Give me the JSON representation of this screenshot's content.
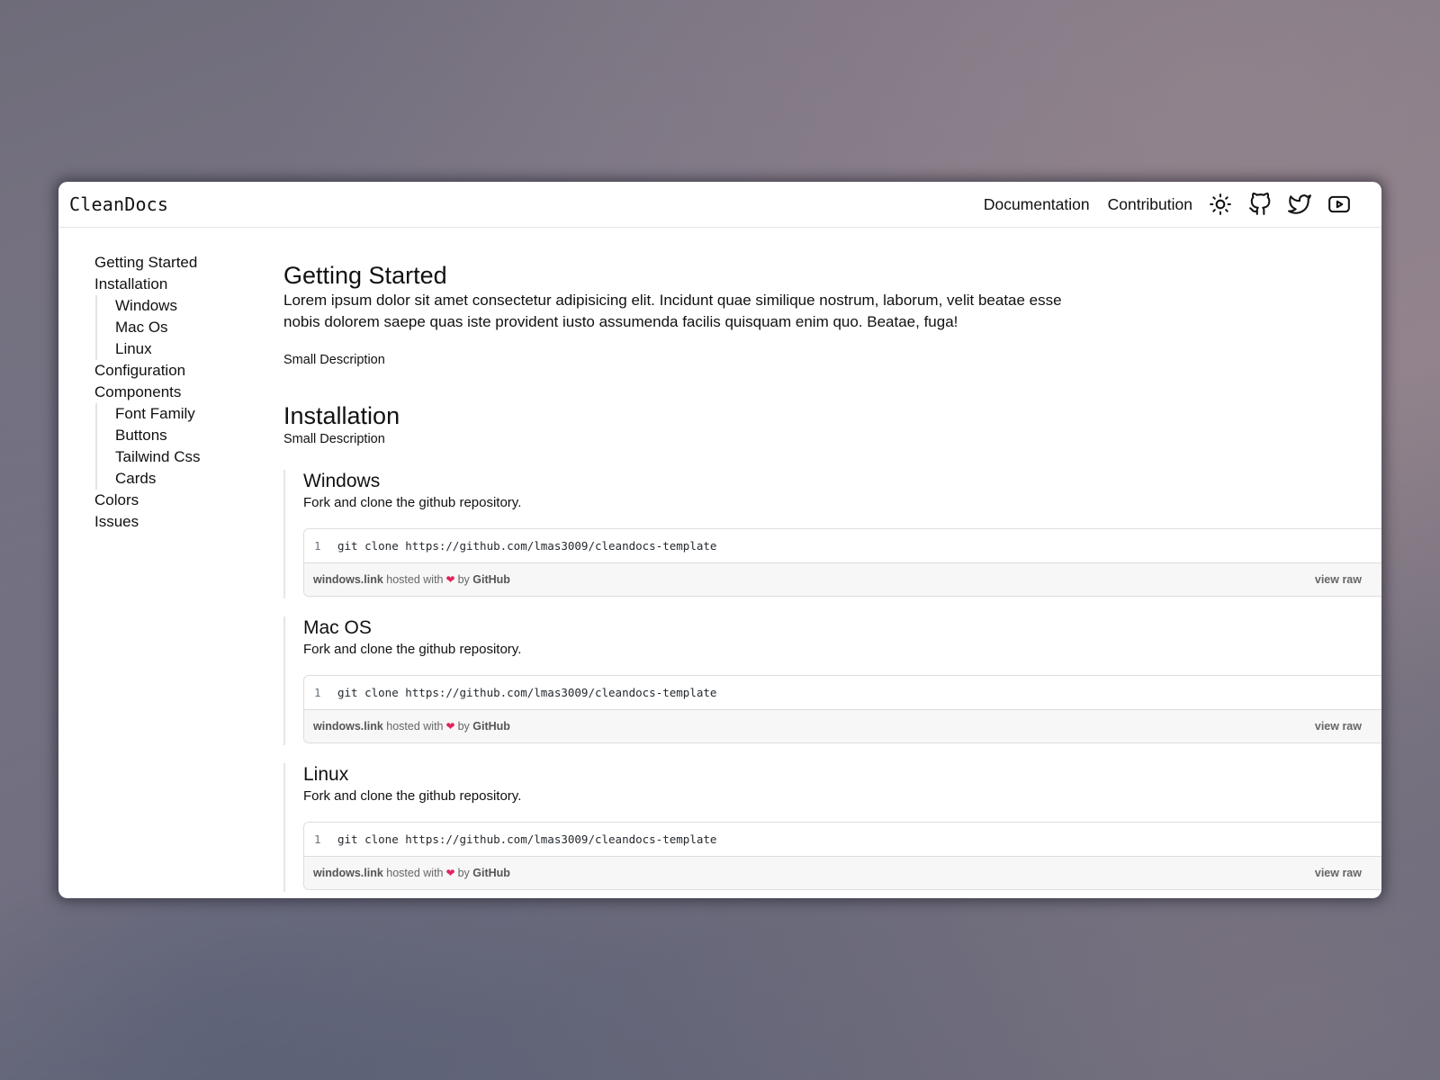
{
  "app": {
    "logo": "CleanDocs"
  },
  "nav": {
    "links": [
      "Documentation",
      "Contribution"
    ],
    "icons": [
      "sun-icon",
      "github-icon",
      "twitter-icon",
      "youtube-icon"
    ]
  },
  "sidebar": {
    "getting_started": "Getting Started",
    "installation": "Installation",
    "installation_children": [
      "Windows",
      "Mac Os",
      "Linux"
    ],
    "configuration": "Configuration",
    "components": "Components",
    "components_children": [
      "Font Family",
      "Buttons",
      "Tailwind Css",
      "Cards"
    ],
    "colors": "Colors",
    "issues": "Issues"
  },
  "main": {
    "getting_started": {
      "title": "Getting Started",
      "body": "Lorem ipsum dolor sit amet consectetur adipisicing elit. Incidunt quae similique nostrum, laborum, velit beatae esse nobis dolorem saepe quas iste provident iusto assumenda facilis quisquam enim quo. Beatae, fuga!",
      "small": "Small Description"
    },
    "installation": {
      "title": "Installation",
      "small": "Small Description",
      "sections": [
        {
          "title": "Windows",
          "desc": "Fork and clone the github repository.",
          "gist": {
            "line_no": "1",
            "code": "git clone https://github.com/lmas3009/cleandocs-template",
            "file": "windows.link",
            "hosted": "hosted with",
            "heart": "❤",
            "by": "by",
            "host": "GitHub",
            "raw": "view raw"
          }
        },
        {
          "title": "Mac OS",
          "desc": "Fork and clone the github repository.",
          "gist": {
            "line_no": "1",
            "code": "git clone https://github.com/lmas3009/cleandocs-template",
            "file": "windows.link",
            "hosted": "hosted with",
            "heart": "❤",
            "by": "by",
            "host": "GitHub",
            "raw": "view raw"
          }
        },
        {
          "title": "Linux",
          "desc": "Fork and clone the github repository.",
          "gist": {
            "line_no": "1",
            "code": "git clone https://github.com/lmas3009/cleandocs-template",
            "file": "windows.link",
            "hosted": "hosted with",
            "heart": "❤",
            "by": "by",
            "host": "GitHub",
            "raw": "view raw"
          }
        }
      ]
    }
  }
}
